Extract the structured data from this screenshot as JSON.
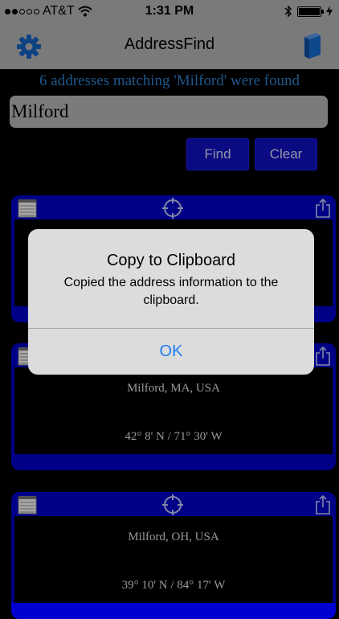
{
  "status_bar": {
    "carrier": "AT&T",
    "time": "1:31 PM"
  },
  "nav": {
    "title": "AddressFind",
    "left_icon": "gear-icon",
    "right_icon": "book-icon"
  },
  "search": {
    "result_message": "6 addresses matching 'Milford' were found",
    "query": "Milford",
    "find_label": "Find",
    "clear_label": "Clear"
  },
  "results": [
    {
      "address": "",
      "coords": ""
    },
    {
      "address": "Milford, MA, USA",
      "coords": "42° 8' N / 71° 30' W"
    },
    {
      "address": "Milford, OH, USA",
      "coords": "39° 10' N / 84° 17' W"
    }
  ],
  "alert": {
    "title": "Copy to Clipboard",
    "message": "Copied the address information to the clipboard.",
    "ok_label": "OK"
  },
  "colors": {
    "accent_blue": "#1010c8",
    "link_blue": "#1f7df2",
    "message_blue": "#2f86d8"
  }
}
